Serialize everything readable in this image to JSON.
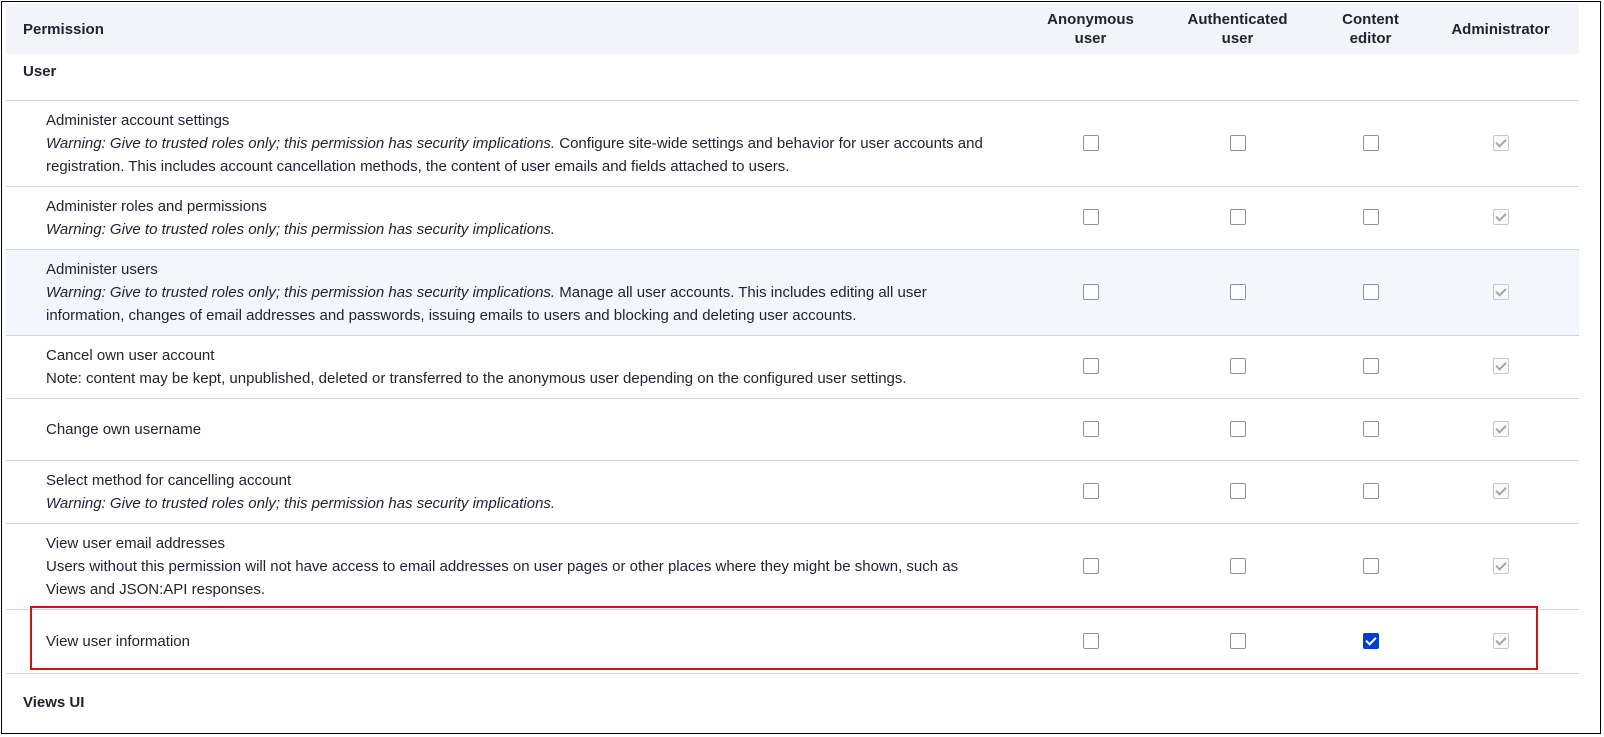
{
  "header": {
    "permission_label": "Permission",
    "roles": [
      {
        "line1": "Anonymous",
        "line2": "user"
      },
      {
        "line1": "Authenticated",
        "line2": "user"
      },
      {
        "line1": "Content",
        "line2": "editor"
      },
      {
        "line1": "Administrator",
        "line2": ""
      }
    ]
  },
  "modules": {
    "user": "User",
    "views_ui": "Views UI"
  },
  "permissions": [
    {
      "title": "Administer account settings",
      "warning": "Warning: Give to trusted roles only; this permission has security implications.",
      "description": " Configure site-wide settings and behavior for user accounts and registration. This includes account cancellation methods, the content of user emails and fields attached to users.",
      "anonymous": false,
      "authenticated": false,
      "content_editor": false,
      "administrator": true
    },
    {
      "title": "Administer roles and permissions",
      "warning": "Warning: Give to trusted roles only; this permission has security implications.",
      "description": "",
      "anonymous": false,
      "authenticated": false,
      "content_editor": false,
      "administrator": true
    },
    {
      "title": "Administer users",
      "warning": "Warning: Give to trusted roles only; this permission has security implications.",
      "description": " Manage all user accounts. This includes editing all user information, changes of email addresses and passwords, issuing emails to users and blocking and deleting user accounts.",
      "anonymous": false,
      "authenticated": false,
      "content_editor": false,
      "administrator": true
    },
    {
      "title": "Cancel own user account",
      "warning": "",
      "description": "Note: content may be kept, unpublished, deleted or transferred to the anonymous user depending on the configured user settings.",
      "anonymous": false,
      "authenticated": false,
      "content_editor": false,
      "administrator": true
    },
    {
      "title": "Change own username",
      "warning": "",
      "description": "",
      "anonymous": false,
      "authenticated": false,
      "content_editor": false,
      "administrator": true
    },
    {
      "title": "Select method for cancelling account",
      "warning": "Warning: Give to trusted roles only; this permission has security implications.",
      "description": "",
      "anonymous": false,
      "authenticated": false,
      "content_editor": false,
      "administrator": true
    },
    {
      "title": "View user email addresses",
      "warning": "",
      "description": "Users without this permission will not have access to email addresses on user pages or other places where they might be shown, such as Views and JSON:API responses.",
      "anonymous": false,
      "authenticated": false,
      "content_editor": false,
      "administrator": true
    },
    {
      "title": "View user information",
      "warning": "",
      "description": "",
      "anonymous": false,
      "authenticated": false,
      "content_editor": true,
      "administrator": true
    }
  ],
  "colors": {
    "checked": "#003ecc",
    "highlight_border": "#c8161d",
    "header_bg": "#f3f4f9",
    "row_highlight_bg": "#f3f6fd"
  }
}
